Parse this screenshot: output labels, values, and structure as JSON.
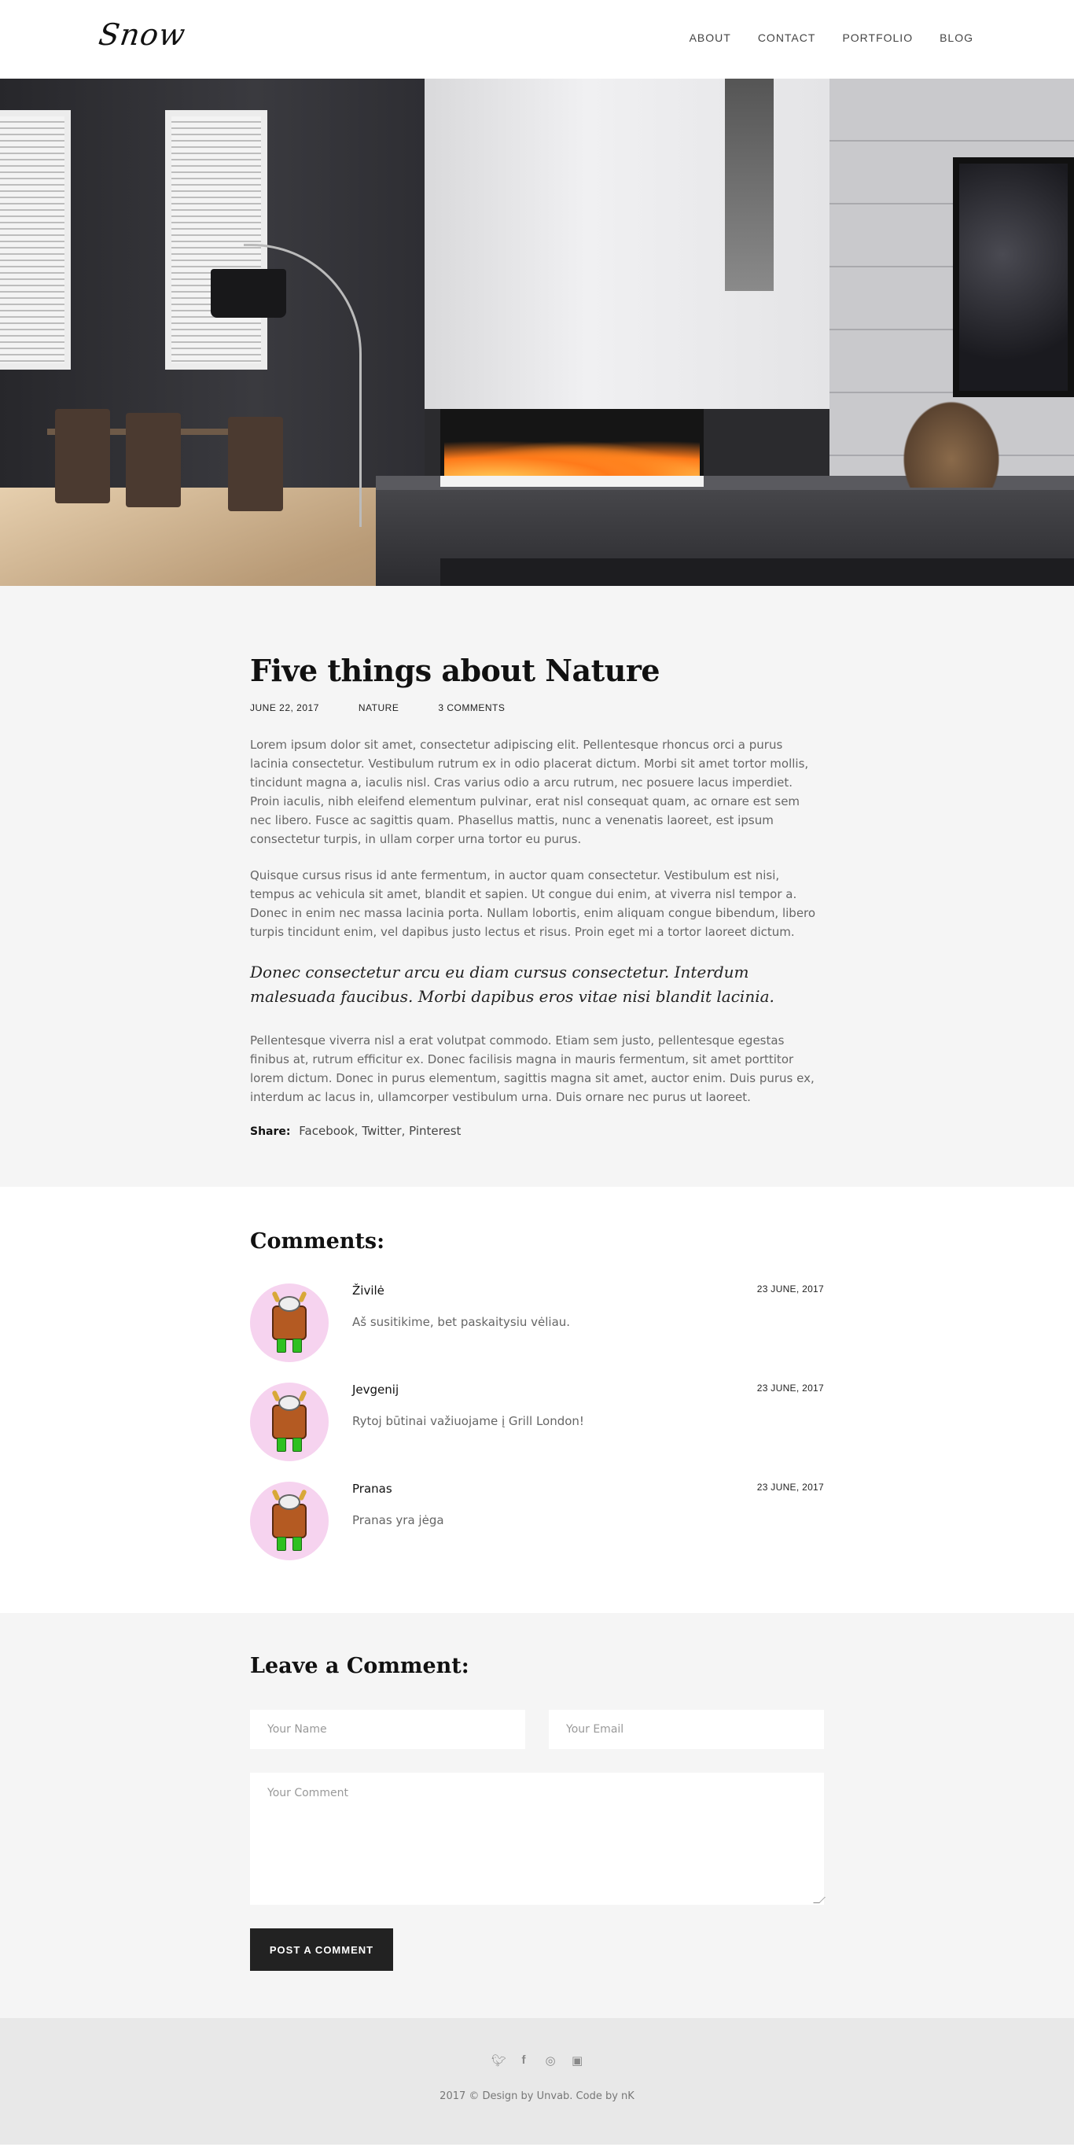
{
  "header": {
    "logo": "Snow",
    "nav": [
      "ABOUT",
      "CONTACT",
      "PORTFOLIO",
      "BLOG"
    ]
  },
  "post": {
    "title": "Five things about Nature",
    "date": "JUNE 22, 2017",
    "category": "NATURE",
    "comments_count": "3 COMMENTS",
    "paragraphs": [
      "Lorem ipsum dolor sit amet, consectetur adipiscing elit. Pellentesque rhoncus orci a purus lacinia consectetur. Vestibulum rutrum ex in odio placerat dictum. Morbi sit amet tortor mollis, tincidunt magna a, iaculis nisl. Cras varius odio a arcu rutrum, nec posuere lacus imperdiet. Proin iaculis, nibh eleifend elementum pulvinar, erat nisl consequat quam, ac ornare est sem nec libero. Fusce ac sagittis quam. Phasellus mattis, nunc a venenatis laoreet, est ipsum consectetur turpis, in ullam corper urna tortor eu purus.",
      "Quisque cursus risus id ante fermentum, in auctor quam consectetur. Vestibulum est nisi, tempus ac vehicula sit amet, blandit et sapien. Ut congue dui enim, at viverra nisl tempor a. Donec in enim nec massa lacinia porta. Nullam lobortis, enim aliquam congue bibendum, libero turpis tincidunt enim, vel dapibus justo lectus et risus. Proin eget mi a tortor laoreet dictum."
    ],
    "quote": "Donec consectetur arcu eu diam cursus consectetur. Interdum malesuada faucibus. Morbi dapibus eros vitae nisi blandit lacinia.",
    "closing": "Pellentesque viverra nisl a erat volutpat commodo. Etiam sem justo, pellentesque egestas finibus at, rutrum efficitur ex. Donec facilisis magna in mauris fermentum, sit amet porttitor lorem dictum. Donec in purus elementum, sagittis magna sit amet, auctor enim. Duis purus ex, interdum ac lacus in, ullamcorper vestibulum urna. Duis ornare nec purus ut laoreet.",
    "share_label": "Share:",
    "share_links": [
      "Facebook",
      "Twitter",
      "Pinterest"
    ]
  },
  "comments": {
    "title": "Comments:",
    "items": [
      {
        "name": "Živilė",
        "date": "23 JUNE, 2017",
        "text": "Aš susitikime, bet paskaitysiu vėliau."
      },
      {
        "name": "Jevgenij",
        "date": "23 JUNE, 2017",
        "text": "Rytoj būtinai važiuojame į Grill London!"
      },
      {
        "name": "Pranas",
        "date": "23 JUNE, 2017",
        "text": "Pranas yra jėga"
      }
    ]
  },
  "form": {
    "title": "Leave a Comment:",
    "name_placeholder": "Your Name",
    "email_placeholder": "Your Email",
    "comment_placeholder": "Your Comment",
    "submit_label": "POST A COMMENT"
  },
  "footer": {
    "social_icons": [
      "twitter-icon",
      "facebook-icon",
      "dribbble-icon",
      "instagram-icon"
    ],
    "copyright": "2017 © Design by Unvab. Code by nK"
  }
}
